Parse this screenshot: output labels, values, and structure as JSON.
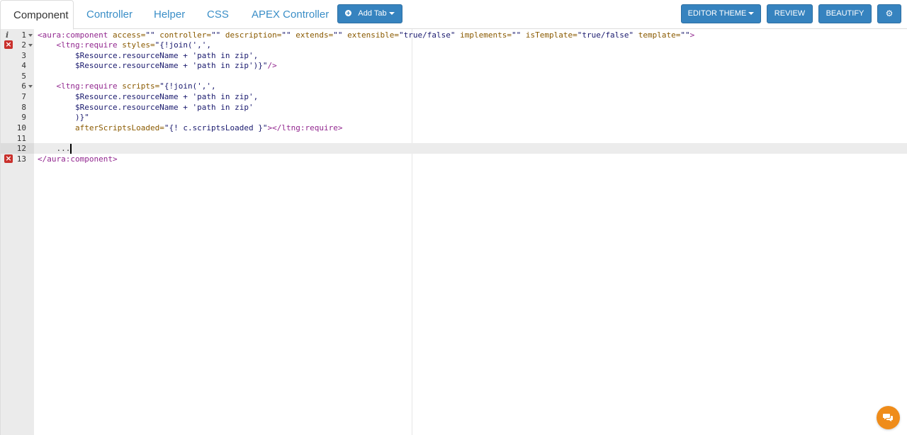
{
  "tabs": [
    {
      "label": "Component",
      "active": true
    },
    {
      "label": "Controller"
    },
    {
      "label": "Helper"
    },
    {
      "label": "CSS"
    },
    {
      "label": "APEX Controller"
    }
  ],
  "toolbar": {
    "add_tab_label": "Add Tab",
    "editor_theme_label": "EDITOR THEME",
    "review_label": "REVIEW",
    "beautify_label": "BEAUTIFY",
    "settings_icon": "gear-icon"
  },
  "colors": {
    "primary_button": "#3683bf",
    "tag": "#92278f",
    "attr": "#8a5a00",
    "error": "#c9302c",
    "chat": "#ef8c1a"
  },
  "editor": {
    "lines": [
      {
        "n": "1",
        "marker": "info",
        "fold": true
      },
      {
        "n": "2",
        "marker": "error",
        "fold": true
      },
      {
        "n": "3"
      },
      {
        "n": "4"
      },
      {
        "n": "5"
      },
      {
        "n": "6",
        "fold": true
      },
      {
        "n": "7"
      },
      {
        "n": "8"
      },
      {
        "n": "9"
      },
      {
        "n": "10"
      },
      {
        "n": "11"
      },
      {
        "n": "12",
        "active": true
      },
      {
        "n": "13",
        "marker": "error"
      }
    ],
    "code": {
      "l1_tag": "<aura:component",
      "l1_attrs": [
        {
          "name": " access=",
          "value": "\"\""
        },
        {
          "name": " controller=",
          "value": "\"\""
        },
        {
          "name": " description=",
          "value": "\"\""
        },
        {
          "name": " extends=",
          "value": "\"\""
        },
        {
          "name": " extensible=",
          "value": "\"true/false\""
        },
        {
          "name": " implements=",
          "value": "\"\""
        },
        {
          "name": " isTemplate=",
          "value": "\"true/false\""
        },
        {
          "name": " template=",
          "value": "\"\""
        }
      ],
      "l1_close": ">",
      "l2_indent": "    ",
      "l2_tag": "<ltng:require",
      "l2_attr": " styles=",
      "l2_value": "\"{!join(',',",
      "l3": "        $Resource.resourceName + 'path in zip',",
      "l4_text": "        $Resource.resourceName + 'path in zip')}\"",
      "l4_close": "/>",
      "l6_indent": "    ",
      "l6_tag": "<ltng:require",
      "l6_attr": " scripts=",
      "l6_value": "\"{!join(',',",
      "l7": "        $Resource.resourceName + 'path in zip',",
      "l8": "        $Resource.resourceName + 'path in zip'",
      "l9": "        )}\"",
      "l10_indent": "        ",
      "l10_attr": "afterScriptsLoaded=",
      "l10_value": "\"{! c.scriptsLoaded }\"",
      "l10_close": "></ltng:require>",
      "l12": "    ...",
      "l13_tag": "</aura:component>"
    }
  }
}
